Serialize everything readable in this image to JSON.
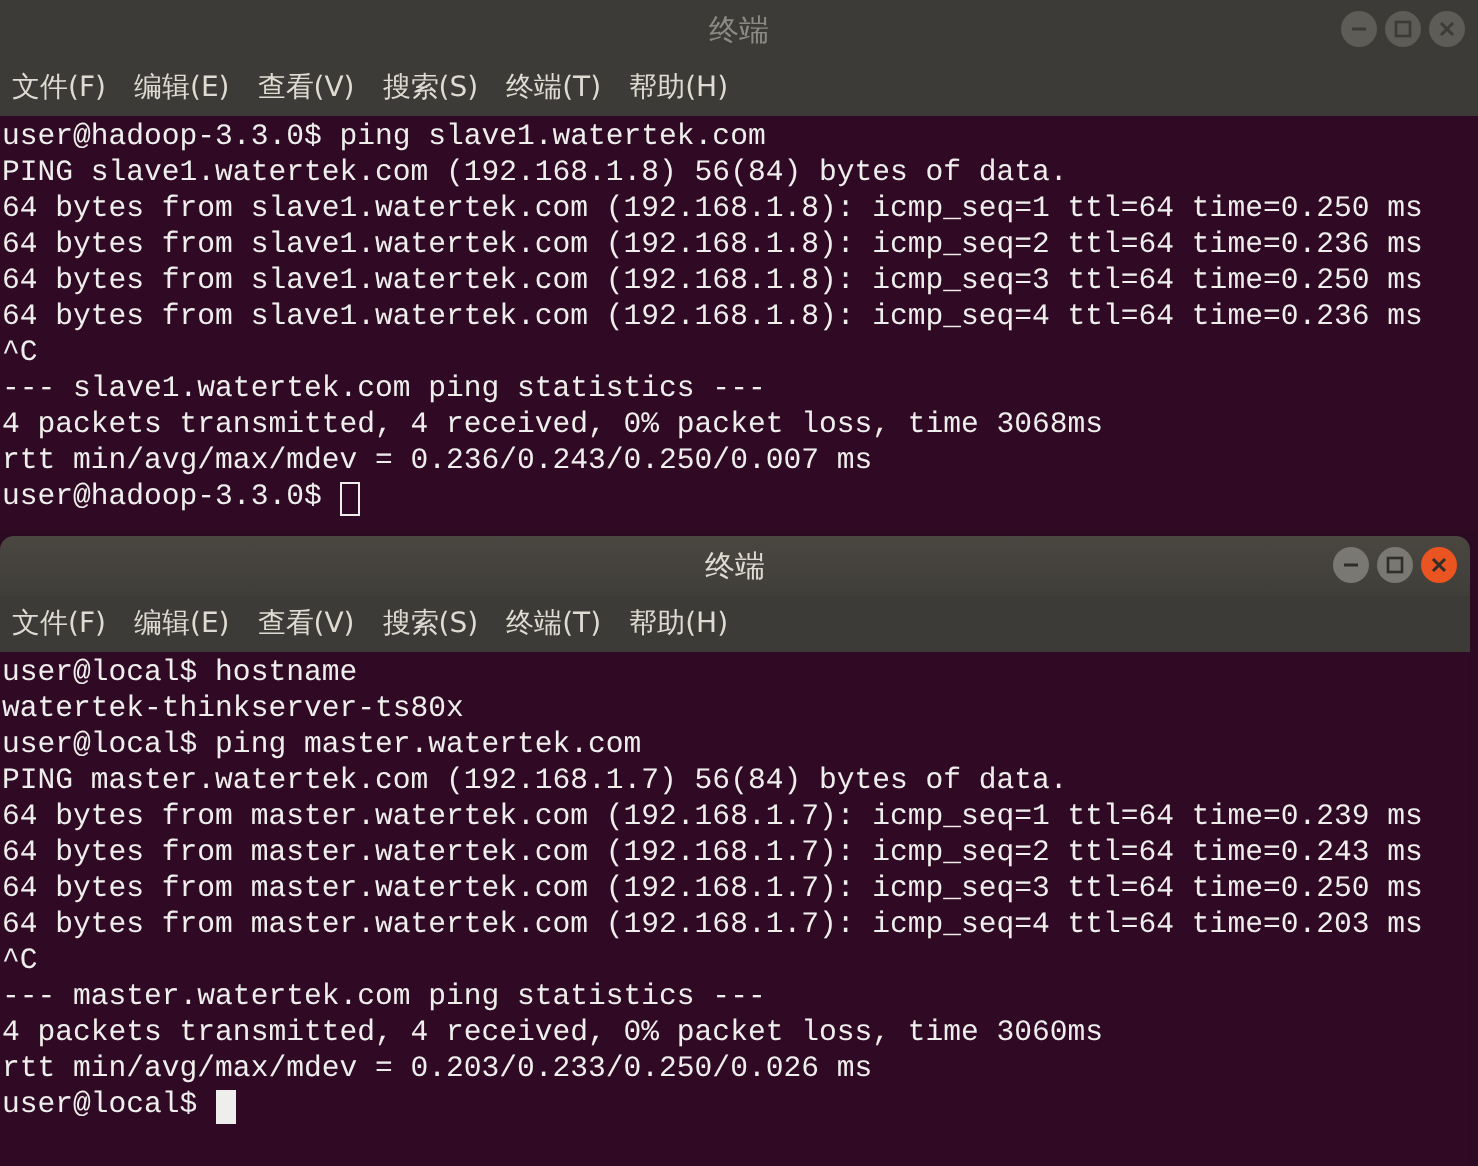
{
  "windows": [
    {
      "title": "终端",
      "active": false,
      "menu": [
        "文件(F)",
        "编辑(E)",
        "查看(V)",
        "搜索(S)",
        "终端(T)",
        "帮助(H)"
      ],
      "lines": [
        "user@hadoop-3.3.0$ ping slave1.watertek.com",
        "PING slave1.watertek.com (192.168.1.8) 56(84) bytes of data.",
        "64 bytes from slave1.watertek.com (192.168.1.8): icmp_seq=1 ttl=64 time=0.250 ms",
        "64 bytes from slave1.watertek.com (192.168.1.8): icmp_seq=2 ttl=64 time=0.236 ms",
        "64 bytes from slave1.watertek.com (192.168.1.8): icmp_seq=3 ttl=64 time=0.250 ms",
        "64 bytes from slave1.watertek.com (192.168.1.8): icmp_seq=4 ttl=64 time=0.236 ms",
        "^C",
        "--- slave1.watertek.com ping statistics ---",
        "4 packets transmitted, 4 received, 0% packet loss, time 3068ms",
        "rtt min/avg/max/mdev = 0.236/0.243/0.250/0.007 ms",
        "user@hadoop-3.3.0$ "
      ]
    },
    {
      "title": "终端",
      "active": true,
      "menu": [
        "文件(F)",
        "编辑(E)",
        "查看(V)",
        "搜索(S)",
        "终端(T)",
        "帮助(H)"
      ],
      "lines": [
        "user@local$ hostname",
        "watertek-thinkserver-ts80x",
        "user@local$ ping master.watertek.com",
        "PING master.watertek.com (192.168.1.7) 56(84) bytes of data.",
        "64 bytes from master.watertek.com (192.168.1.7): icmp_seq=1 ttl=64 time=0.239 ms",
        "64 bytes from master.watertek.com (192.168.1.7): icmp_seq=2 ttl=64 time=0.243 ms",
        "64 bytes from master.watertek.com (192.168.1.7): icmp_seq=3 ttl=64 time=0.250 ms",
        "64 bytes from master.watertek.com (192.168.1.7): icmp_seq=4 ttl=64 time=0.203 ms",
        "^C",
        "--- master.watertek.com ping statistics ---",
        "4 packets transmitted, 4 received, 0% packet loss, time 3060ms",
        "rtt min/avg/max/mdev = 0.203/0.233/0.250/0.026 ms",
        "user@local$ "
      ]
    }
  ]
}
